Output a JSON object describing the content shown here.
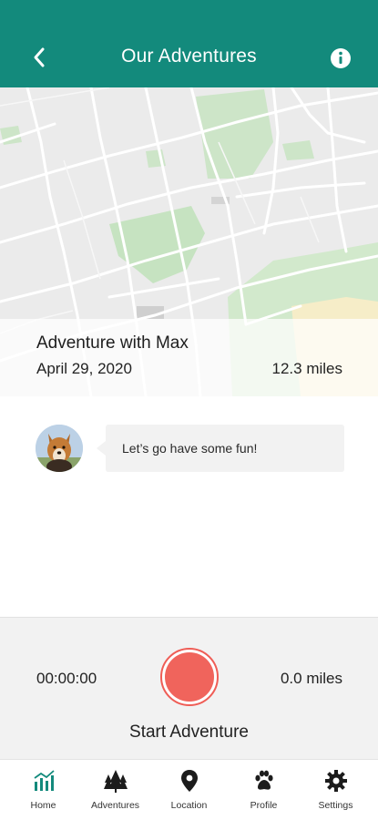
{
  "header": {
    "title": "Our Adventures",
    "back_icon": "chevron-left-icon",
    "info_icon": "info-circle-icon",
    "color": "#138a7c"
  },
  "adventure": {
    "title": "Adventure with Max",
    "date": "April 29, 2020",
    "distance": "12.3 miles"
  },
  "message": {
    "text": "Let’s go have some fun!",
    "avatar": "dog-avatar"
  },
  "tracker": {
    "time": "00:00:00",
    "distance": "0.0 miles",
    "start_label": "Start Adventure",
    "record_color": "#f0645c"
  },
  "tabs": [
    {
      "label": "Home",
      "icon": "chart-icon",
      "active": true
    },
    {
      "label": "Adventures",
      "icon": "trees-icon"
    },
    {
      "label": "Location",
      "icon": "location-pin-icon"
    },
    {
      "label": "Profile",
      "icon": "paw-icon"
    },
    {
      "label": "Settings",
      "icon": "gear-icon"
    }
  ],
  "colors": {
    "accent": "#138a7c",
    "record": "#f0645c",
    "park": "#c8e6c4"
  }
}
